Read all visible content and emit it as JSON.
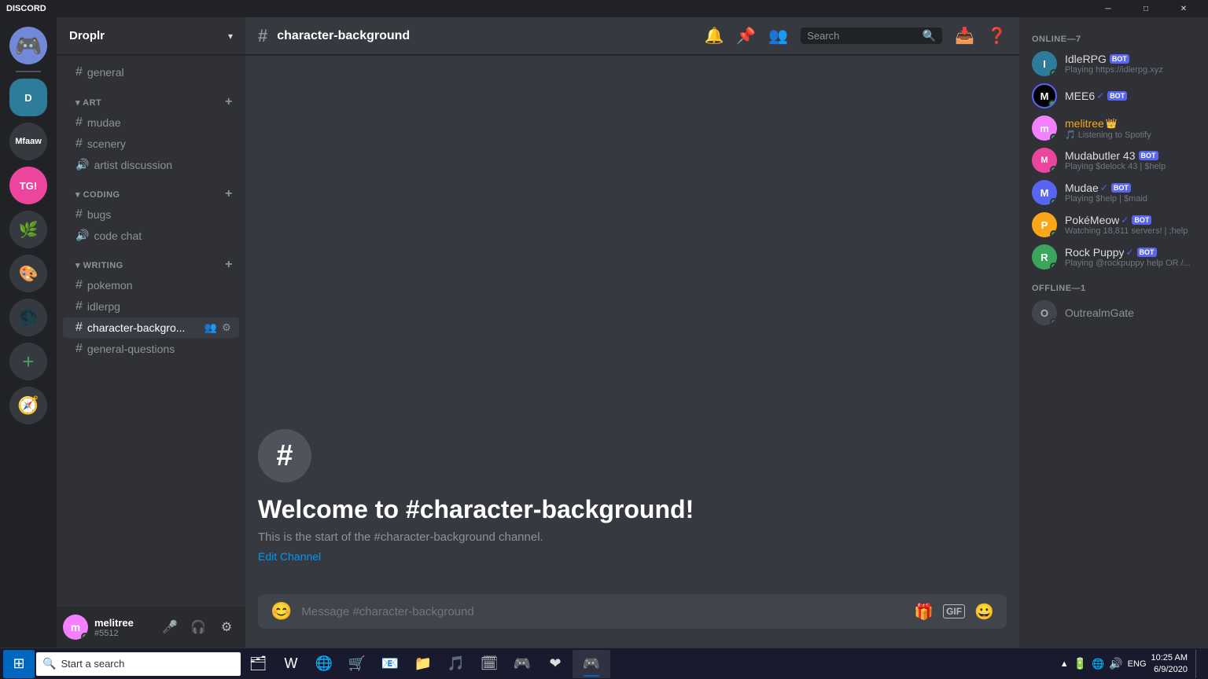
{
  "titlebar": {
    "logo": "DISCORD",
    "minimize": "─",
    "maximize": "□",
    "close": "✕"
  },
  "server": {
    "name": "Droplr",
    "chevron": "▾"
  },
  "sidebar": {
    "general_channel": "general",
    "categories": [
      {
        "name": "ART",
        "channels": [
          {
            "name": "mudae",
            "type": "text"
          },
          {
            "name": "scenery",
            "type": "text"
          },
          {
            "name": "artist discussion",
            "type": "voice"
          }
        ]
      },
      {
        "name": "CODING",
        "channels": [
          {
            "name": "bugs",
            "type": "text"
          },
          {
            "name": "code chat",
            "type": "voice"
          }
        ]
      },
      {
        "name": "WRITING",
        "channels": [
          {
            "name": "pokemon",
            "type": "text"
          },
          {
            "name": "idlerpg",
            "type": "text"
          },
          {
            "name": "character-backgro...",
            "type": "text",
            "active": true
          },
          {
            "name": "general-questions",
            "type": "text"
          }
        ]
      }
    ],
    "user": {
      "name": "melitree",
      "tag": "#5512",
      "avatar_color": "#f47fff"
    }
  },
  "channel": {
    "name": "character-background",
    "welcome_title": "Welcome to #character-background!",
    "welcome_desc": "This is the start of the #character-background channel.",
    "edit_link": "Edit Channel",
    "message_placeholder": "Message #character-background"
  },
  "header_search": {
    "placeholder": "Search",
    "icon": "🔍"
  },
  "members": {
    "online_label": "ONLINE—7",
    "offline_label": "OFFLINE—1",
    "online": [
      {
        "name": "IdleRPG",
        "badge": "BOT",
        "status": "Playing https://idlerpg.xyz",
        "avatar_color": "#7289da"
      },
      {
        "name": "MEE6",
        "badge": "BOT",
        "verified": true,
        "status": "",
        "avatar_color": "#000000"
      },
      {
        "name": "melitree",
        "crown": true,
        "status": "Listening to Spotify",
        "avatar_color": "#f47fff"
      },
      {
        "name": "Mudabutler 43",
        "badge": "BOT",
        "status": "Playing $delock 43 | $help",
        "avatar_color": "#eb459e"
      },
      {
        "name": "Mudae",
        "badge": "BOT",
        "verified": true,
        "status": "Playing $help | $maid",
        "avatar_color": "#5865f2"
      },
      {
        "name": "PokéMeow",
        "badge": "BOT",
        "verified": true,
        "status": "Watching 18,811 servers! | ;help",
        "avatar_color": "#faa61a"
      },
      {
        "name": "Rock Puppy",
        "badge": "BOT",
        "verified": true,
        "status": "Playing @rockpuppy help OR /...",
        "avatar_color": "#3ba55c"
      }
    ],
    "offline": [
      {
        "name": "OutrealmGate",
        "status": "",
        "avatar_color": "#4f545c"
      }
    ]
  },
  "taskbar": {
    "search_text": "Start a search",
    "apps": [
      "⊞",
      "🗂",
      "W",
      "🌐",
      "🛒",
      "📧",
      "📁",
      "♪",
      "🗓",
      "🎮",
      "❤"
    ],
    "sys_icons": [
      "🔼",
      "🔋",
      "🔊",
      "ENG"
    ],
    "time": "10:25 AM",
    "date": "6/9/2020"
  }
}
